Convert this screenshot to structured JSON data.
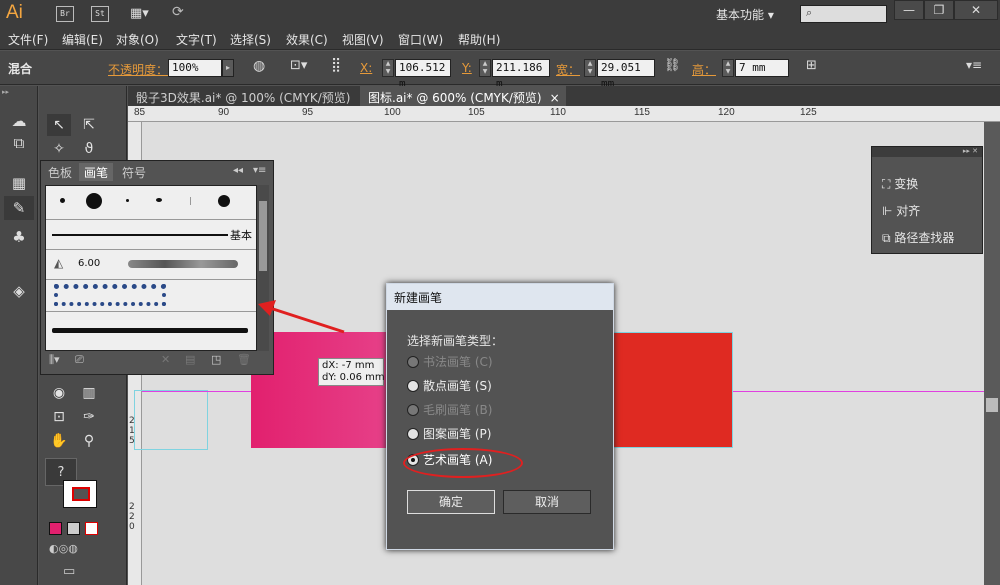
{
  "app": {
    "logo": "Ai",
    "workspace": "基本功能",
    "buttons": [
      "Br",
      "St"
    ]
  },
  "menu": [
    "文件(F)",
    "编辑(E)",
    "对象(O)",
    "文字(T)",
    "选择(S)",
    "效果(C)",
    "视图(V)",
    "窗口(W)",
    "帮助(H)"
  ],
  "control_bar": {
    "label": "混合",
    "opacity_label": "不透明度：",
    "opacity_value": "100%",
    "x_label": "X:",
    "x_value": "106.512 m",
    "y_label": "Y:",
    "y_value": "211.186 m",
    "w_label": "宽：",
    "w_value": "29.051 mm",
    "h_label": "高：",
    "h_value": "7 mm"
  },
  "tabs": [
    {
      "label": "骰子3D效果.ai* @ 100% (CMYK/预览)",
      "active": false
    },
    {
      "label": "图标.ai* @ 600% (CMYK/预览)",
      "active": true
    }
  ],
  "ruler": {
    "h_ticks": [
      "85",
      "90",
      "95",
      "100",
      "105",
      "110",
      "115",
      "120",
      "125"
    ],
    "v_ticks": [
      "2 1 5",
      "2 2 0"
    ]
  },
  "brush_panel": {
    "tabs": [
      "色板",
      "画笔",
      "符号"
    ],
    "active_tab": "画笔",
    "basic_label": "基本",
    "size_label": "6.00"
  },
  "right_panel": {
    "items": [
      "变换",
      "对齐",
      "路径查找器"
    ]
  },
  "drag_tooltip": {
    "dx": "dX: -7 mm",
    "dy": "dY: 0.06 mm"
  },
  "dialog": {
    "title": "新建画笔",
    "prompt": "选择新画笔类型：",
    "options": [
      {
        "label": "书法画笔 (C)",
        "enabled": false,
        "selected": false
      },
      {
        "label": "散点画笔 (S)",
        "enabled": true,
        "selected": false
      },
      {
        "label": "毛刷画笔 (B)",
        "enabled": false,
        "selected": false
      },
      {
        "label": "图案画笔 (P)",
        "enabled": true,
        "selected": false
      },
      {
        "label": "艺术画笔 (A)",
        "enabled": true,
        "selected": true
      }
    ],
    "ok": "确定",
    "cancel": "取消"
  },
  "colors": {
    "pink": "#e2206e",
    "red": "#df2a22",
    "highlight": "#e02020",
    "guide": "#e040e0"
  }
}
